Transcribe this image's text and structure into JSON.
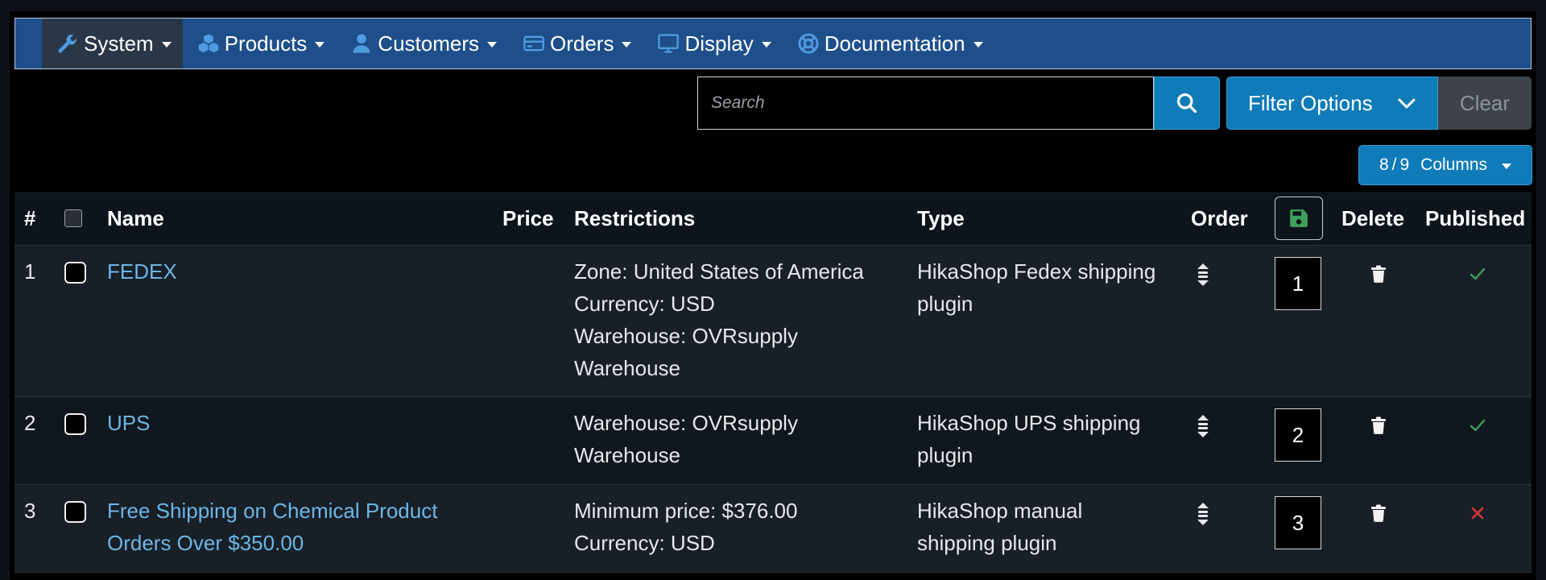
{
  "nav": {
    "items": [
      {
        "label": "System",
        "icon": "wrench-icon"
      },
      {
        "label": "Products",
        "icon": "cubes-icon"
      },
      {
        "label": "Customers",
        "icon": "user-icon"
      },
      {
        "label": "Orders",
        "icon": "credit-card-icon"
      },
      {
        "label": "Display",
        "icon": "monitor-icon"
      },
      {
        "label": "Documentation",
        "icon": "life-ring-icon"
      }
    ]
  },
  "toolbar": {
    "search_placeholder": "Search",
    "filter_label": "Filter Options",
    "clear_label": "Clear",
    "columns_shown": "8",
    "columns_sep": "/",
    "columns_total": "9",
    "columns_label": "Columns"
  },
  "table": {
    "headers": {
      "num": "#",
      "name": "Name",
      "price": "Price",
      "restrictions": "Restrictions",
      "type": "Type",
      "order": "Order",
      "delete": "Delete",
      "published": "Published"
    },
    "rows": [
      {
        "num": "1",
        "name": [
          "FEDEX"
        ],
        "restrictions": [
          "Zone: United States of America",
          "Currency: USD",
          "Warehouse: OVRsupply",
          "Warehouse"
        ],
        "type": [
          "HikaShop Fedex shipping",
          "plugin"
        ],
        "order": "1",
        "published": true
      },
      {
        "num": "2",
        "name": [
          "UPS"
        ],
        "restrictions": [
          "Warehouse: OVRsupply",
          "Warehouse"
        ],
        "type": [
          "HikaShop UPS shipping",
          "plugin"
        ],
        "order": "2",
        "published": true
      },
      {
        "num": "3",
        "name": [
          "Free Shipping on Chemical Product",
          "Orders Over $350.00"
        ],
        "restrictions": [
          "Minimum price: $376.00",
          "Currency: USD"
        ],
        "type": [
          "HikaShop manual",
          "shipping plugin"
        ],
        "order": "3",
        "published": false
      }
    ]
  },
  "colors": {
    "nav_bg": "#1e4f8a",
    "primary": "#0f7bb8",
    "link": "#6cb6e6",
    "published_yes": "#3fa15a",
    "published_no": "#d9363e",
    "save_icon": "#3fa15a"
  }
}
